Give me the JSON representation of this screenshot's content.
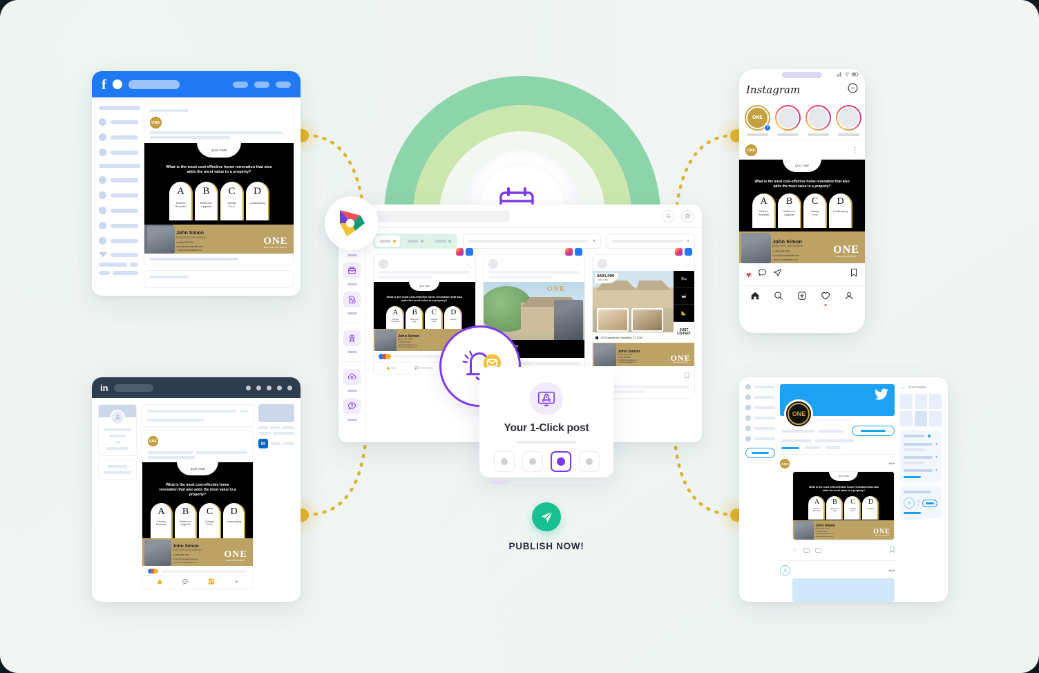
{
  "creative": {
    "tab_label": "QUIZ TIME",
    "question": "What is the most cost-effective home renovation that also adds the most value to a property?",
    "options": [
      {
        "letter": "A",
        "text": "Kitchen Remodel"
      },
      {
        "letter": "B",
        "text": "Bathroom Upgrade"
      },
      {
        "letter": "C",
        "text": "Garage Conversion"
      },
      {
        "letter": "D",
        "text": "Landscaping"
      }
    ],
    "agent_name": "John Simon",
    "agent_title": "REALTOR®  |  DRE #0000000",
    "agent_phone": "(555) 555-5555",
    "agent_email": "john@onerealestate.com",
    "agent_site": "www.onerealestate.com",
    "brand_logo": "ONE",
    "brand_tagline": "REAL ESTATE GROUP"
  },
  "facebook": {
    "name": "facebook-window",
    "logo": "f",
    "accent": "#1f79f2"
  },
  "linkedin": {
    "name": "linkedin-window",
    "logo": "in",
    "accent": "#2e3d4d",
    "badge": "in"
  },
  "instagram": {
    "name": "instagram-phone",
    "wordmark": "Instagram",
    "messenger_icon": "messenger-icon",
    "story_label": "ONE",
    "post_avatar": "ONE",
    "actions": [
      "heart-icon",
      "comment-icon",
      "share-icon",
      "bookmark-icon"
    ],
    "tabs": [
      "home-icon",
      "search-icon",
      "add-post-icon",
      "activity-icon",
      "profile-icon"
    ]
  },
  "twitter": {
    "name": "twitter-window",
    "bird_icon": "twitter-bird-icon",
    "avatar_label": "ONE",
    "username_label": "Username"
  },
  "dashboard": {
    "app_logo": "play-logo-icon",
    "rail_items": [
      {
        "icon": "home-icon",
        "active": true
      },
      {
        "icon": "folder-icon",
        "active": false
      },
      {
        "icon": "document-icon",
        "active": false
      },
      {
        "icon": "award-icon",
        "active": false
      },
      {
        "icon": "cloud-upload-icon",
        "active": false
      },
      {
        "icon": "help-icon",
        "active": false
      }
    ],
    "topbar_icons": [
      "bell-icon",
      "account-icon"
    ],
    "tab_count": 3,
    "dropdown_count": 2,
    "feed_cards": [
      {
        "type": "quiz",
        "platforms": [
          "instagram",
          "facebook"
        ]
      },
      {
        "type": "house-photo",
        "platforms": [
          "instagram",
          "facebook"
        ]
      },
      {
        "type": "just-listed",
        "platforms": [
          "instagram",
          "facebook"
        ]
      }
    ]
  },
  "listing_card": {
    "price": "$401,000",
    "beds_baths": "3 BD | 2 BA",
    "just_listed": "JUST LISTED!",
    "address_line": "1234 Example Ave, Springfield, ST 12345"
  },
  "oneclick": {
    "rocket_icon": "rocket-screen-icon",
    "title": "Your 1-Click post",
    "radio_count": 4,
    "selected_index": 2
  },
  "publish": {
    "send_icon": "paper-plane-icon",
    "label": "PUBLISH NOW!",
    "accent": "#18c08f"
  },
  "center_icons": {
    "calendar": "calendar-stopwatch-icon",
    "notification": "bell-envelope-icon"
  },
  "colors": {
    "purple": "#7c3aed",
    "gold": "#e0b32a",
    "green": "#18c08f",
    "facebook_blue": "#1f79f2",
    "twitter_blue": "#1da1f2",
    "brand_gold": "#bda266",
    "arc_green_outer": "#8cd4a9",
    "arc_green_mid": "#cbe7ae"
  }
}
